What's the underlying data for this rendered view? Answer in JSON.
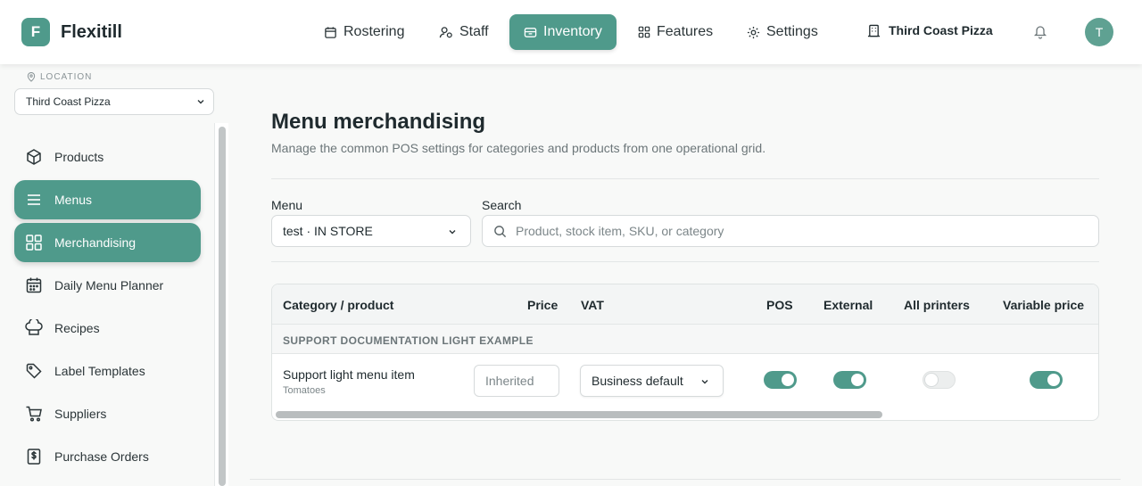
{
  "app": {
    "logo_letter": "F",
    "name": "Flexitill"
  },
  "nav": {
    "rostering": "Rostering",
    "staff": "Staff",
    "inventory": "Inventory",
    "features": "Features",
    "settings": "Settings"
  },
  "header": {
    "store": "Third Coast Pizza",
    "avatar_letter": "T"
  },
  "location": {
    "label": "LOCATION",
    "value": "Third Coast Pizza"
  },
  "sidebar": {
    "items": [
      {
        "label": "Products"
      },
      {
        "label": "Menus"
      },
      {
        "label": "Merchandising"
      },
      {
        "label": "Daily Menu Planner"
      },
      {
        "label": "Recipes"
      },
      {
        "label": "Label Templates"
      },
      {
        "label": "Suppliers"
      },
      {
        "label": "Purchase Orders"
      }
    ]
  },
  "page": {
    "title": "Menu merchandising",
    "subtitle": "Manage the common POS settings for categories and products from one operational grid."
  },
  "filters": {
    "menu_label": "Menu",
    "menu_value": "test · IN STORE",
    "search_label": "Search",
    "search_placeholder": "Product, stock item, SKU, or category"
  },
  "table": {
    "columns": [
      "Category / product",
      "Price",
      "VAT",
      "POS",
      "External",
      "All printers",
      "Variable price"
    ],
    "category": "SUPPORT DOCUMENTATION LIGHT EXAMPLE",
    "row": {
      "name": "Support light menu item",
      "sub": "Tomatoes",
      "price_placeholder": "Inherited",
      "vat": "Business default",
      "pos": true,
      "external": true,
      "all_printers": false,
      "variable_price": true
    }
  },
  "colors": {
    "accent": "#4f9a8b"
  }
}
